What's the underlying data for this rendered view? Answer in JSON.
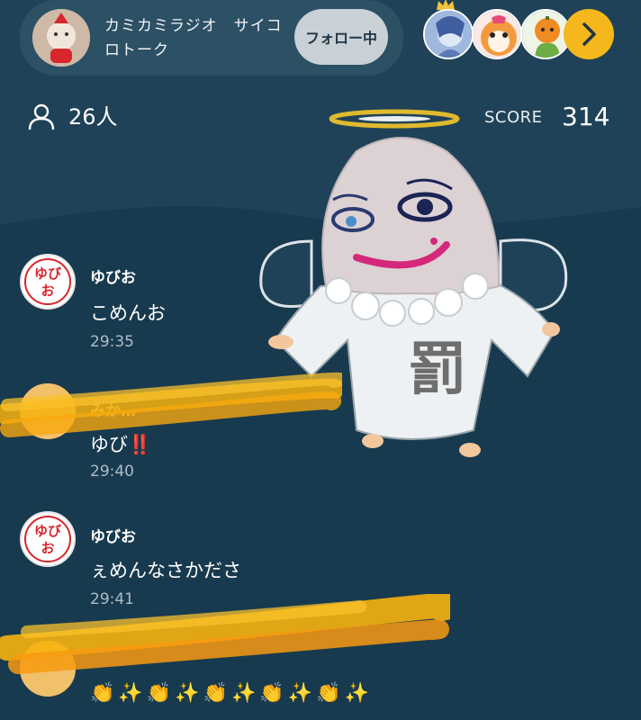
{
  "header": {
    "room_title": "カミカミラジオ　サイコロトーク",
    "follow_label": "フォロー中",
    "listeners": [
      "listener-1",
      "listener-2",
      "listener-3"
    ]
  },
  "stats": {
    "listener_count": "26人",
    "score_label": "SCORE",
    "score_value": "314"
  },
  "sticker": {
    "text": "罰"
  },
  "comments": [
    {
      "name": "ゆびお",
      "avatar_text": "ゆび\nお",
      "text": "こめんお",
      "time": "29:35"
    },
    {
      "name": "みか…",
      "avatar_text": "",
      "text": "ゆび‼️",
      "time": "29:40"
    },
    {
      "name": "ゆびお",
      "avatar_text": "ゆび\nお",
      "text": "ぇめんなさかださ",
      "time": "29:41"
    }
  ],
  "emoji_row": "👏✨👏✨👏✨👏✨👏✨",
  "colors": {
    "accent": "#f4b81c",
    "follow_bg": "#c9d1d6",
    "bg_top": "#1f4258",
    "bg_bottom": "#183a4f",
    "scribble": "#f7b20e"
  }
}
